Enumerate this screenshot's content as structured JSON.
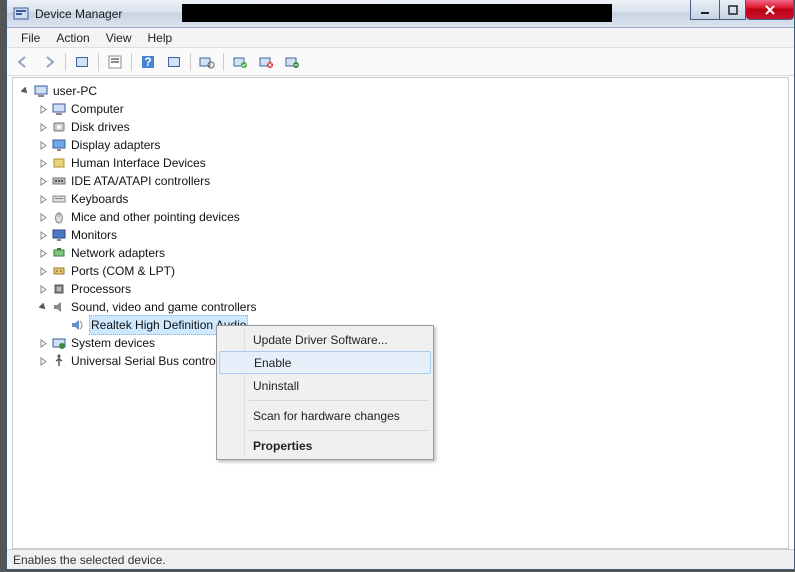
{
  "window": {
    "title": "Device Manager"
  },
  "menu": {
    "file": "File",
    "action": "Action",
    "view": "View",
    "help": "Help"
  },
  "tree": {
    "root": "user-PC",
    "items": [
      "Computer",
      "Disk drives",
      "Display adapters",
      "Human Interface Devices",
      "IDE ATA/ATAPI controllers",
      "Keyboards",
      "Mice and other pointing devices",
      "Monitors",
      "Network adapters",
      "Ports (COM & LPT)",
      "Processors"
    ],
    "expanded": {
      "label": "Sound, video and game controllers",
      "child": "Realtek High Definition Audio"
    },
    "after": [
      "System devices",
      "Universal Serial Bus controllers"
    ]
  },
  "context": {
    "items": [
      "Update Driver Software...",
      "Enable",
      "Uninstall",
      "Scan for hardware changes",
      "Properties"
    ]
  },
  "status": "Enables the selected device."
}
